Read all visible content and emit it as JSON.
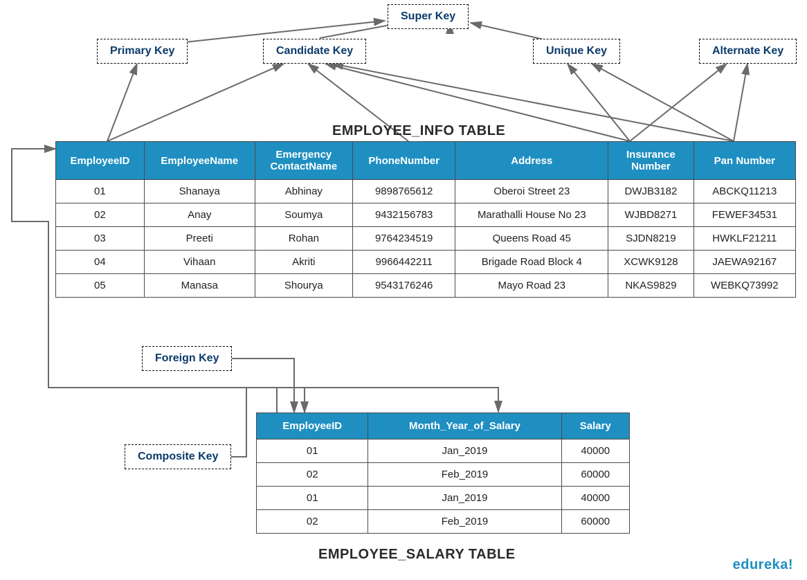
{
  "keys": {
    "super": "Super Key",
    "primary": "Primary Key",
    "candidate": "Candidate Key",
    "unique": "Unique Key",
    "alternate": "Alternate Key",
    "foreign": "Foreign Key",
    "composite": "Composite Key"
  },
  "tables": {
    "employee_info": {
      "title": "EMPLOYEE_INFO TABLE",
      "headers": [
        "EmployeeID",
        "EmployeeName",
        "Emergency ContactName",
        "PhoneNumber",
        "Address",
        "Insurance Number",
        "Pan Number"
      ],
      "rows": [
        [
          "01",
          "Shanaya",
          "Abhinay",
          "9898765612",
          "Oberoi Street 23",
          "DWJB3182",
          "ABCKQ11213"
        ],
        [
          "02",
          "Anay",
          "Soumya",
          "9432156783",
          "Marathalli House No 23",
          "WJBD8271",
          "FEWEF34531"
        ],
        [
          "03",
          "Preeti",
          "Rohan",
          "9764234519",
          "Queens Road 45",
          "SJDN8219",
          "HWKLF21211"
        ],
        [
          "04",
          "Vihaan",
          "Akriti",
          "9966442211",
          "Brigade Road Block 4",
          "XCWK9128",
          "JAEWA92167"
        ],
        [
          "05",
          "Manasa",
          "Shourya",
          "9543176246",
          "Mayo Road 23",
          "NKAS9829",
          "WEBKQ73992"
        ]
      ]
    },
    "employee_salary": {
      "title": "EMPLOYEE_SALARY TABLE",
      "headers": [
        "EmployeeID",
        "Month_Year_of_Salary",
        "Salary"
      ],
      "rows": [
        [
          "01",
          "Jan_2019",
          "40000"
        ],
        [
          "02",
          "Feb_2019",
          "60000"
        ],
        [
          "01",
          "Jan_2019",
          "40000"
        ],
        [
          "02",
          "Feb_2019",
          "60000"
        ]
      ]
    }
  },
  "watermark": "edureka!"
}
